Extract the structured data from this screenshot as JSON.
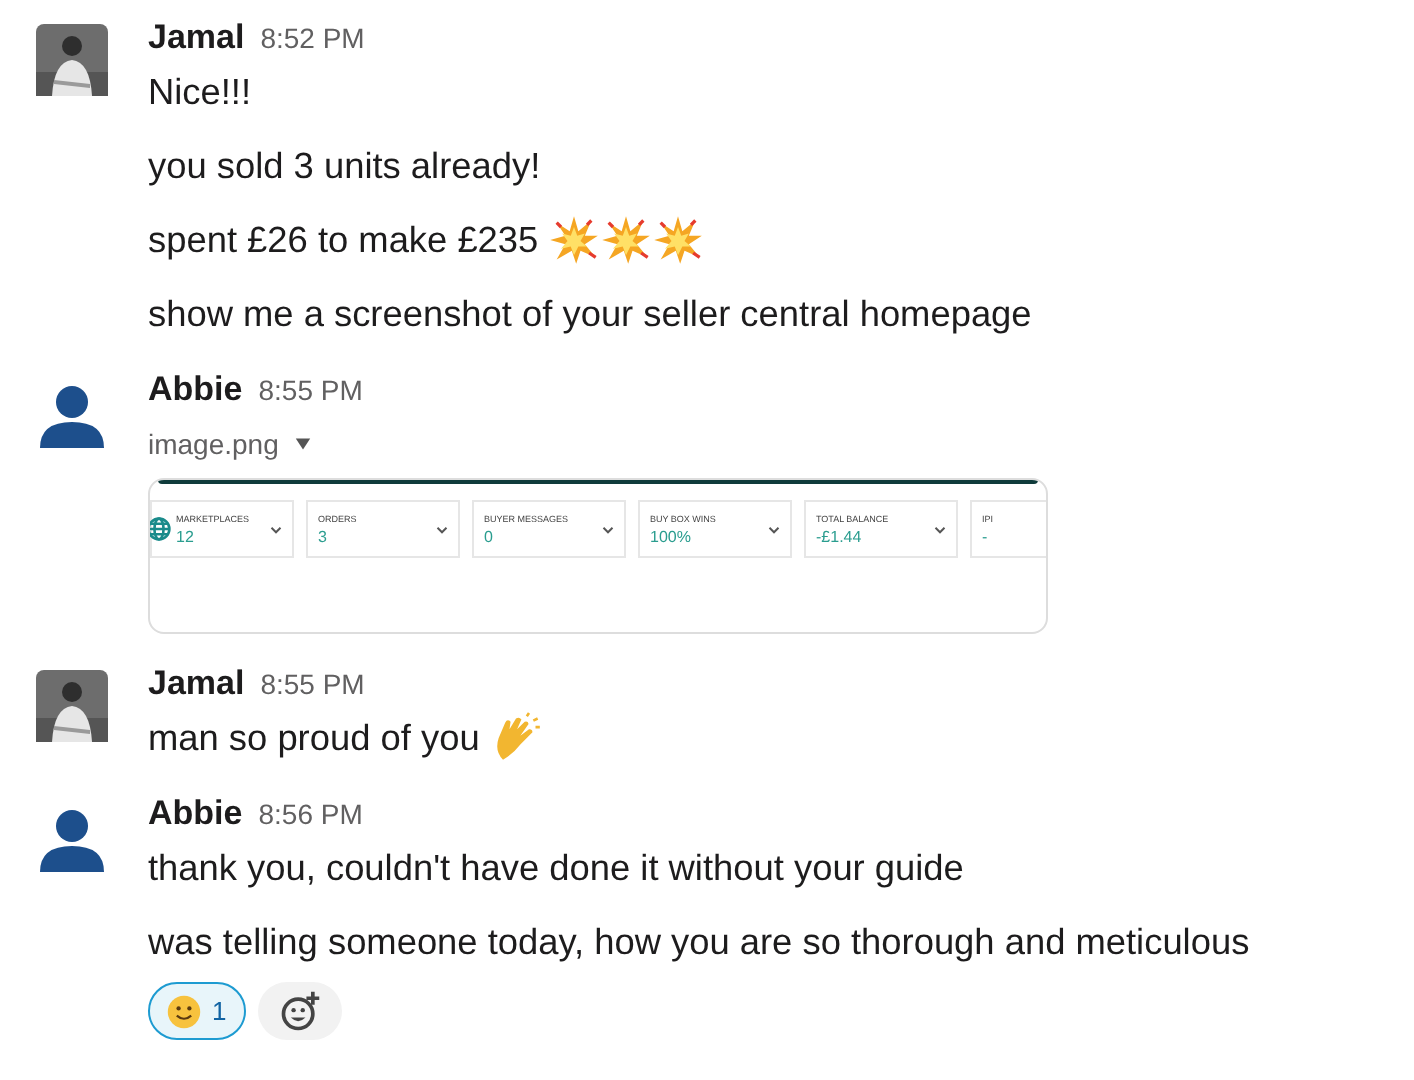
{
  "messages": [
    {
      "author": "Jamal",
      "time": "8:52 PM",
      "items": [
        {
          "kind": "text",
          "text": "Nice!!!"
        },
        {
          "kind": "text",
          "text": "you sold 3 units already!"
        },
        {
          "kind": "text",
          "text": "spent £26 to make £235",
          "emojis": [
            {
              "kind": "collision"
            },
            {
              "kind": "collision"
            },
            {
              "kind": "collision"
            }
          ]
        },
        {
          "kind": "text",
          "text": "show me a screenshot of your seller central homepage"
        }
      ]
    },
    {
      "author": "Abbie",
      "time": "8:55 PM",
      "avatar": {
        "kind": "default"
      },
      "items": [
        {
          "kind": "attachment",
          "filename": "image.png",
          "cards": [
            {
              "label": "MARKETPLACES",
              "value": "12",
              "globe": true,
              "dropdown": true
            },
            {
              "label": "ORDERS",
              "value": "3",
              "globe": false,
              "dropdown": true
            },
            {
              "label": "BUYER MESSAGES",
              "value": "0",
              "globe": false,
              "dropdown": true
            },
            {
              "label": "BUY BOX WINS",
              "value": "100%",
              "globe": false,
              "dropdown": true
            },
            {
              "label": "TOTAL BALANCE",
              "value": "-£1.44",
              "globe": false,
              "dropdown": true
            },
            {
              "label": "IPI",
              "value": "-",
              "globe": false
            }
          ]
        }
      ]
    },
    {
      "author": "Jamal",
      "time": "8:55 PM",
      "items": [
        {
          "kind": "text",
          "text": "man so proud of you",
          "emojis": [
            {
              "kind": "clap"
            }
          ]
        }
      ]
    },
    {
      "author": "Abbie",
      "time": "8:56 PM",
      "avatar": {
        "kind": "default"
      },
      "items": [
        {
          "kind": "text",
          "text": "thank you, couldn't have done it without your guide"
        },
        {
          "kind": "text",
          "text": "was telling someone today, how you are so thorough and meticulous"
        },
        {
          "kind": "reactions",
          "reactions": [
            {
              "kind": "smile",
              "count": "1",
              "selected": true
            }
          ]
        }
      ]
    }
  ]
}
